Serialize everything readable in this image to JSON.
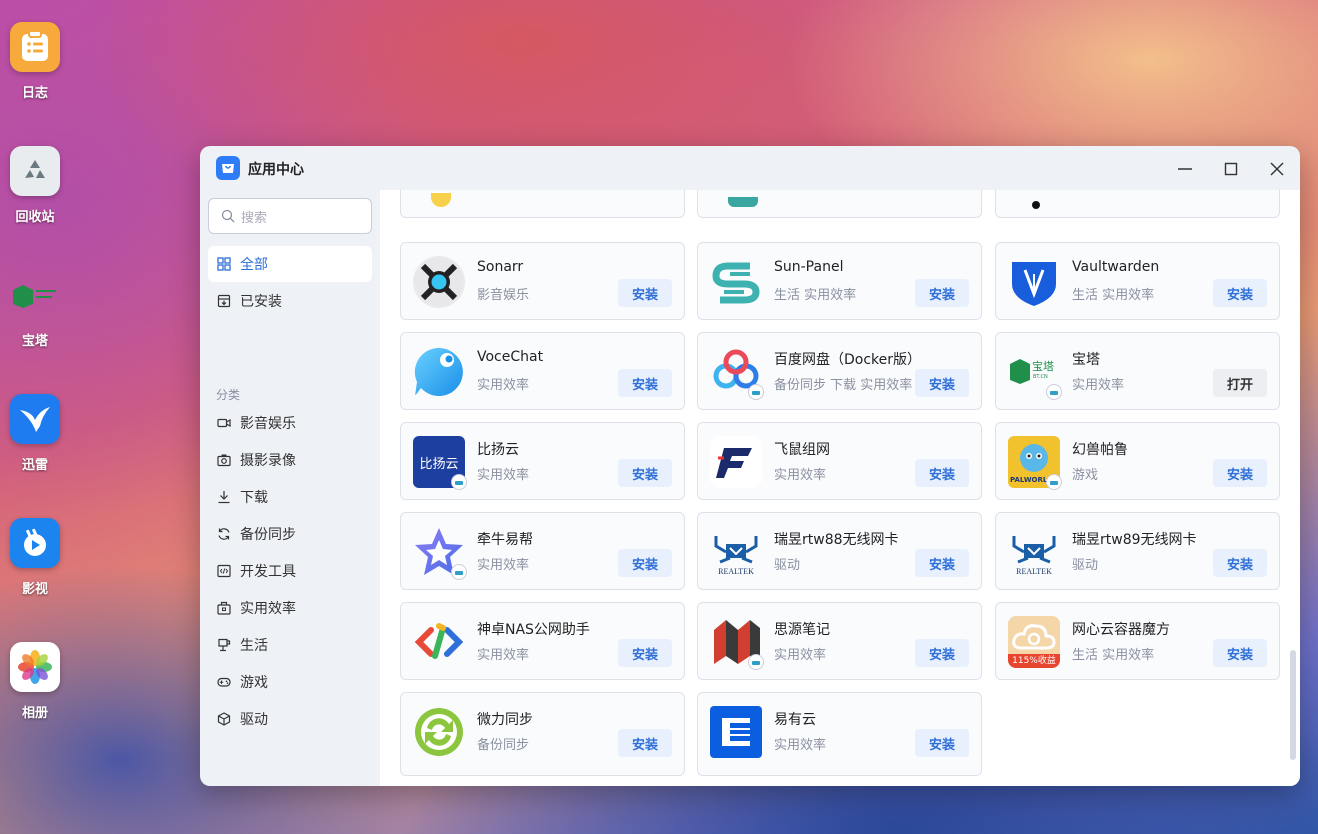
{
  "desktop": {
    "icons": [
      {
        "label": "日志",
        "icon": "notes-icon"
      },
      {
        "label": "回收站",
        "icon": "recycle-bin-icon"
      },
      {
        "label": "宝塔",
        "icon": "baota-icon"
      },
      {
        "label": "迅雷",
        "icon": "thunder-icon"
      },
      {
        "label": "影视",
        "icon": "video-icon"
      },
      {
        "label": "相册",
        "icon": "photos-icon"
      }
    ]
  },
  "window": {
    "title": "应用中心",
    "controls": [
      "minimize",
      "maximize",
      "close"
    ]
  },
  "sidebar": {
    "search_placeholder": "搜索",
    "main_items": [
      {
        "label": "全部",
        "icon": "grid-icon",
        "active": true
      },
      {
        "label": "已安装",
        "icon": "installed-icon",
        "active": false
      }
    ],
    "category_title": "分类",
    "categories": [
      {
        "label": "影音娱乐",
        "icon": "video-camera-icon"
      },
      {
        "label": "摄影录像",
        "icon": "camera-icon"
      },
      {
        "label": "下载",
        "icon": "download-icon"
      },
      {
        "label": "备份同步",
        "icon": "sync-icon"
      },
      {
        "label": "开发工具",
        "icon": "code-icon"
      },
      {
        "label": "实用效率",
        "icon": "toolbox-icon"
      },
      {
        "label": "生活",
        "icon": "life-icon"
      },
      {
        "label": "游戏",
        "icon": "gamepad-icon"
      },
      {
        "label": "驱动",
        "icon": "cube-icon"
      }
    ]
  },
  "apps": [
    {
      "name": "Sonarr",
      "category": "影音娱乐",
      "action": "安装",
      "icon": "sonarr-icon"
    },
    {
      "name": "Sun-Panel",
      "category": "生活 实用效率",
      "action": "安装",
      "icon": "sun-panel-icon"
    },
    {
      "name": "Vaultwarden",
      "category": "生活 实用效率",
      "action": "安装",
      "icon": "vaultwarden-icon"
    },
    {
      "name": "VoceChat",
      "category": "实用效率",
      "action": "安装",
      "icon": "vocechat-icon"
    },
    {
      "name": "百度网盘（Docker版）",
      "category": "备份同步 下载 实用效率",
      "action": "安装",
      "icon": "baidu-netdisk-icon"
    },
    {
      "name": "宝塔",
      "category": "实用效率",
      "action": "打开",
      "icon": "baota-icon"
    },
    {
      "name": "比扬云",
      "category": "实用效率",
      "action": "安装",
      "icon": "biyangyun-icon",
      "icon_text": "比扬云"
    },
    {
      "name": "飞鼠组网",
      "category": "实用效率",
      "action": "安装",
      "icon": "feishu-network-icon"
    },
    {
      "name": "幻兽帕鲁",
      "category": "游戏",
      "action": "安装",
      "icon": "palworld-icon",
      "icon_text": "PALWORLD"
    },
    {
      "name": "牵牛易帮",
      "category": "实用效率",
      "action": "安装",
      "icon": "qianniu-icon"
    },
    {
      "name": "瑞昱rtw88无线网卡",
      "category": "驱动",
      "action": "安装",
      "icon": "realtek-icon",
      "icon_text": "REALTEK"
    },
    {
      "name": "瑞昱rtw89无线网卡",
      "category": "驱动",
      "action": "安装",
      "icon": "realtek-icon",
      "icon_text": "REALTEK"
    },
    {
      "name": "神卓NAS公网助手",
      "category": "实用效率",
      "action": "安装",
      "icon": "shenzhuo-icon"
    },
    {
      "name": "思源笔记",
      "category": "实用效率",
      "action": "安装",
      "icon": "siyuan-icon"
    },
    {
      "name": "网心云容器魔方",
      "category": "生活 实用效率",
      "action": "安装",
      "icon": "wangxin-cloud-icon",
      "icon_text": "115%收益"
    },
    {
      "name": "微力同步",
      "category": "备份同步",
      "action": "安装",
      "icon": "verysync-icon"
    },
    {
      "name": "易有云",
      "category": "实用效率",
      "action": "安装",
      "icon": "yiyouyun-icon"
    }
  ],
  "colors": {
    "accent": "#2f6fd8",
    "button_bg": "#e8f0fd",
    "window_bg": "#eef1f6"
  }
}
